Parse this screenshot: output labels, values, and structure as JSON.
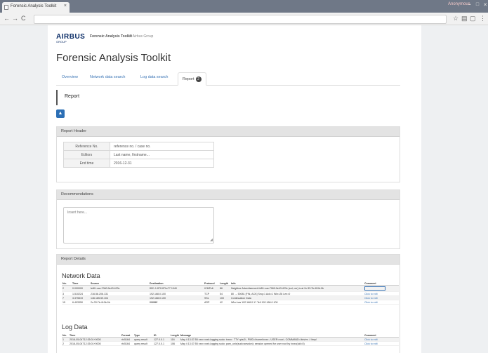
{
  "browser": {
    "tab_title": "Forensic Analysis Toolkit",
    "tab_close": "×",
    "window_user": "Anonymous",
    "window_controls": [
      "–",
      "□",
      "✕"
    ],
    "nav": {
      "back": "←",
      "forward": "→",
      "reload": "C"
    },
    "toolbar_icons": [
      "☆",
      "▤",
      "▢",
      "⋮"
    ]
  },
  "brand": {
    "logo": "AIRBUS",
    "logo_sub": "GROUP",
    "title": "Forensic Analysis Toolkit",
    "copyright": "© Airbus Group"
  },
  "page": {
    "title": "Forensic Analysis Toolkit"
  },
  "tabs": [
    {
      "label": "Overview"
    },
    {
      "label": "Network data search"
    },
    {
      "label": "Log data search"
    },
    {
      "label": "Report",
      "badge": "2",
      "active": true
    }
  ],
  "report": {
    "heading": "Report",
    "upload_icon": "upload-icon"
  },
  "report_header": {
    "title": "Report Header",
    "rows": [
      {
        "key": "Reference No.",
        "value": "reference no. / case no."
      },
      {
        "key": "Editors",
        "value": "Last name, firstname..."
      },
      {
        "key": "End time",
        "value": "2016-12-31"
      }
    ]
  },
  "recommendations": {
    "title": "Recommendations",
    "placeholder": "Insert here..."
  },
  "report_details": {
    "title": "Report Details",
    "network": {
      "title": "Network Data",
      "columns": [
        "No.",
        "Time",
        "Source",
        "Destination",
        "Protocol",
        "Length",
        "Info",
        "Comment"
      ],
      "rows": [
        [
          "2",
          "0.000000",
          "fe80::cac:7060:9e43:423c",
          "ff02::1:ff7f:9f7f:e77 1040",
          "ICMPv6",
          "86",
          "Neighbor Advertisement fe80::cac:7060:9e43:423c (sol, ovr) is at 2c:33:7b:4f:0b:0b",
          ""
        ],
        [
          "3",
          "1.510224",
          "216.58.206.131",
          "192.168.0.100",
          "TCP",
          "54",
          "80 → 50081 [FIN, ACK] Seq=1 Ack=1 Win=28 Len=0",
          "Click to edit"
        ],
        [
          "7",
          "3.375519",
          "146.185.59.104",
          "192.168.0.100",
          "SSL",
          "100",
          "Continuation Data",
          "Click to edit"
        ],
        [
          "15",
          "6.493350",
          "2c:33:7b:4f:0b:0b",
          "ffffffffffff",
          "ARP",
          "42",
          "Who has 192.168.0.1? Tell 192.168.0.100",
          "Click to edit"
        ]
      ]
    },
    "log": {
      "title": "Log Data",
      "columns": [
        "No.",
        "Time",
        "Format",
        "Type",
        "ID",
        "Length",
        "Message",
        "Comment"
      ],
      "rows": [
        [
          "1",
          "2016-05-04T12:35:01+0000",
          "rfc5164",
          "query result",
          "127.0.0.1",
          "116",
          "May 4 13:37:55 xxxx xxxb-logging sudo: txxxx : TTY=pts/0 ; PWD=/home/txxxx ; USER=root ; COMMAND=/bin/rm -f /tmp/",
          "Click to edit"
        ],
        [
          "2",
          "2016-05-04T12:35:01+0000",
          "rfc5164",
          "query result",
          "127.0.0.1",
          "106",
          "May 4 13:37:55 xxxx xxxb-logging sudo: pam_unix(sudo:session): session opened for user root by txxxx(uid=0)",
          "Click to edit"
        ]
      ]
    }
  }
}
